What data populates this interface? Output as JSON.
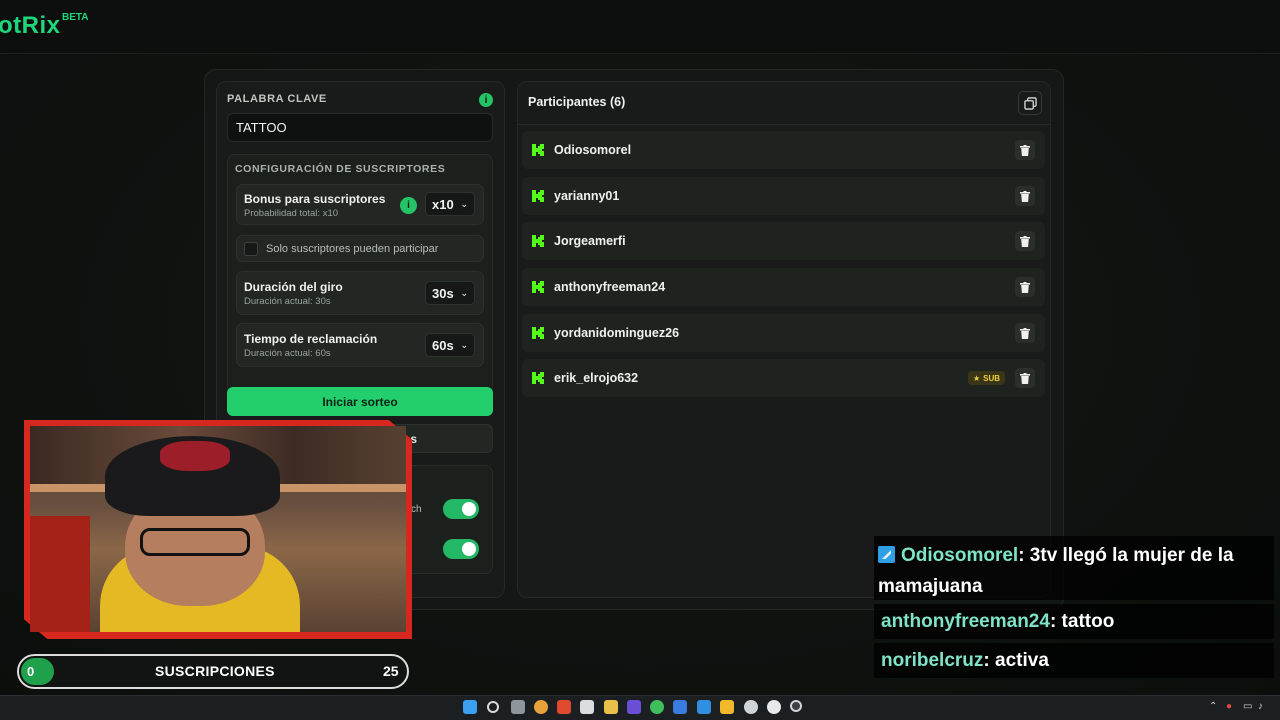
{
  "header": {
    "logo_text": "otRix",
    "badge": "BETA"
  },
  "keyword": {
    "label": "PALABRA CLAVE",
    "info_icon": "i",
    "value": "TATTOO"
  },
  "subscriber_config": {
    "title": "CONFIGURACIÓN DE SUSCRIPTORES",
    "bonus": {
      "title": "Bonus para suscriptores",
      "subtitle": "Probabilidad total: x10",
      "info_icon": "i",
      "value": "x10"
    },
    "only_subs": {
      "label": "Solo suscriptores pueden participar",
      "checked": false
    },
    "spin_duration": {
      "title": "Duración del giro",
      "subtitle": "Duración actual: 30s",
      "value": "30s"
    },
    "claim_time": {
      "title": "Tiempo de reclamación",
      "subtitle": "Duración actual: 60s",
      "value": "60s"
    }
  },
  "actions": {
    "start_label": "Iniciar sorteo",
    "secondary_label_visible": "s"
  },
  "options": {
    "toggle1_label_visible": "ch",
    "toggle1_on": true,
    "toggle2_on": true
  },
  "participants": {
    "title": "Participantes (6)",
    "items": [
      {
        "name": "Odiosomorel",
        "sub": false
      },
      {
        "name": "yarianny01",
        "sub": false
      },
      {
        "name": "Jorgeamerfi",
        "sub": false
      },
      {
        "name": "anthonyfreeman24",
        "sub": false
      },
      {
        "name": "yordanidominguez26",
        "sub": false
      },
      {
        "name": "erik_elrojo632",
        "sub": true,
        "badge": "SUB"
      }
    ]
  },
  "subscriptions_goal": {
    "current": "0",
    "label": "SUSCRIPCIONES",
    "target": "25",
    "progress_fraction": 0
  },
  "chat": [
    {
      "user": "Odiosomorel",
      "text": ": 3tv llegó la mujer de la mamajuana"
    },
    {
      "user": "anthonyfreeman24",
      "text": ": tattoo"
    },
    {
      "user": "noribelcruz",
      "text": ": activa"
    }
  ],
  "colors": {
    "accent": "#22cf6c",
    "kick_green": "#53fc18",
    "overlay_red": "#d7281f",
    "chat_user": "#7fe3c9"
  }
}
